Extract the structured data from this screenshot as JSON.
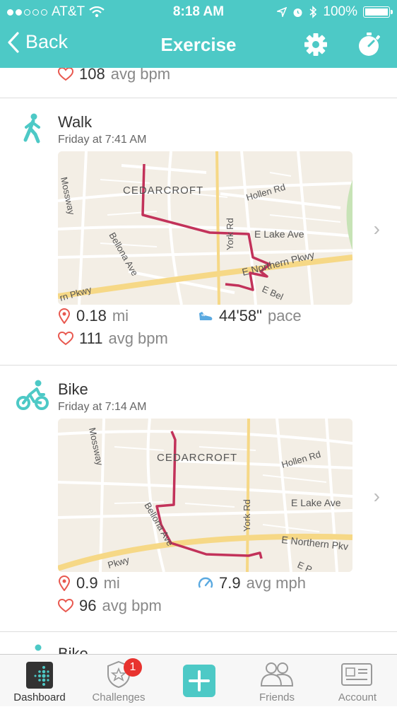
{
  "status": {
    "carrier": "AT&T",
    "time": "8:18 AM",
    "battery": "100%"
  },
  "nav": {
    "back_label": "Back",
    "title": "Exercise"
  },
  "previous_entry": {
    "bpm": "108",
    "bpm_unit": "avg bpm"
  },
  "entries": [
    {
      "type": "Walk",
      "time": "Friday at 7:41 AM",
      "map": {
        "labels": [
          "Mossway",
          "CEDARCROFT",
          "Hollen Rd",
          "E Lake Ave",
          "York Rd",
          "Bellona Ave",
          "E Northern Pkwy",
          "rn Pkwy",
          "E Bel"
        ]
      },
      "distance": "0.18",
      "distance_unit": "mi",
      "pace": "44'58\"",
      "pace_unit": "pace",
      "bpm": "111",
      "bpm_unit": "avg bpm"
    },
    {
      "type": "Bike",
      "time": "Friday at 7:14 AM",
      "map": {
        "labels": [
          "Mossway",
          "CEDARCROFT",
          "Hollen Rd",
          "E Lake Ave",
          "York Rd",
          "Bellona Ave",
          "E Northern Pkv",
          "Pkwy",
          "E P"
        ]
      },
      "distance": "0.9",
      "distance_unit": "mi",
      "speed": "7.9",
      "speed_unit": "avg mph",
      "bpm": "96",
      "bpm_unit": "avg bpm"
    }
  ],
  "next_entry_title": "Bike",
  "tabs": [
    {
      "label": "Dashboard"
    },
    {
      "label": "Challenges",
      "badge": "1"
    },
    {
      "label": "Friends"
    },
    {
      "label": "Account"
    }
  ],
  "colors": {
    "accent": "#4dc9c6",
    "route": "#c2325a",
    "heart": "#e8584f",
    "badge": "#e8332f"
  }
}
